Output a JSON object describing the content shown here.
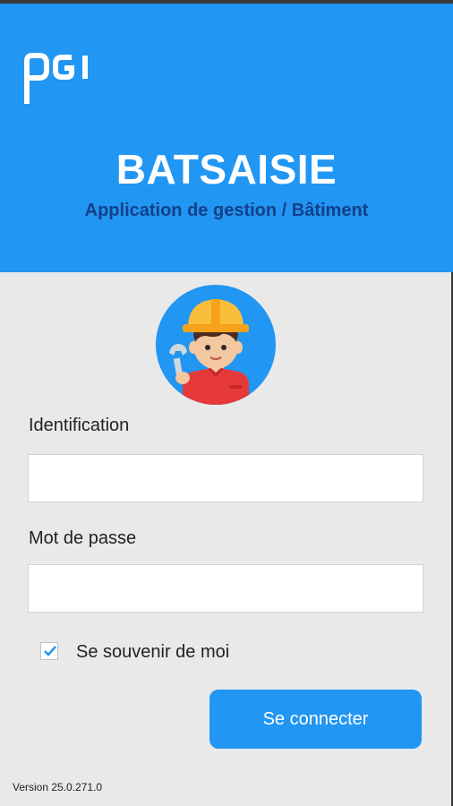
{
  "header": {
    "logo_text": "pgi",
    "app_title": "BATSAISIE",
    "app_subtitle": "Application de gestion / Bâtiment"
  },
  "avatar": {
    "icon": "construction-worker-icon"
  },
  "form": {
    "identification_label": "Identification",
    "identification_value": "",
    "password_label": "Mot de passe",
    "password_value": "",
    "remember_label": "Se souvenir de moi",
    "remember_checked": true,
    "submit_label": "Se connecter"
  },
  "footer": {
    "version": "Version 25.0.271.0"
  },
  "colors": {
    "primary": "#2196f3",
    "subtitle": "#143f8a",
    "background": "#e9e9e9",
    "helmet": "#f9bf3b",
    "shirt": "#e63a3a"
  }
}
